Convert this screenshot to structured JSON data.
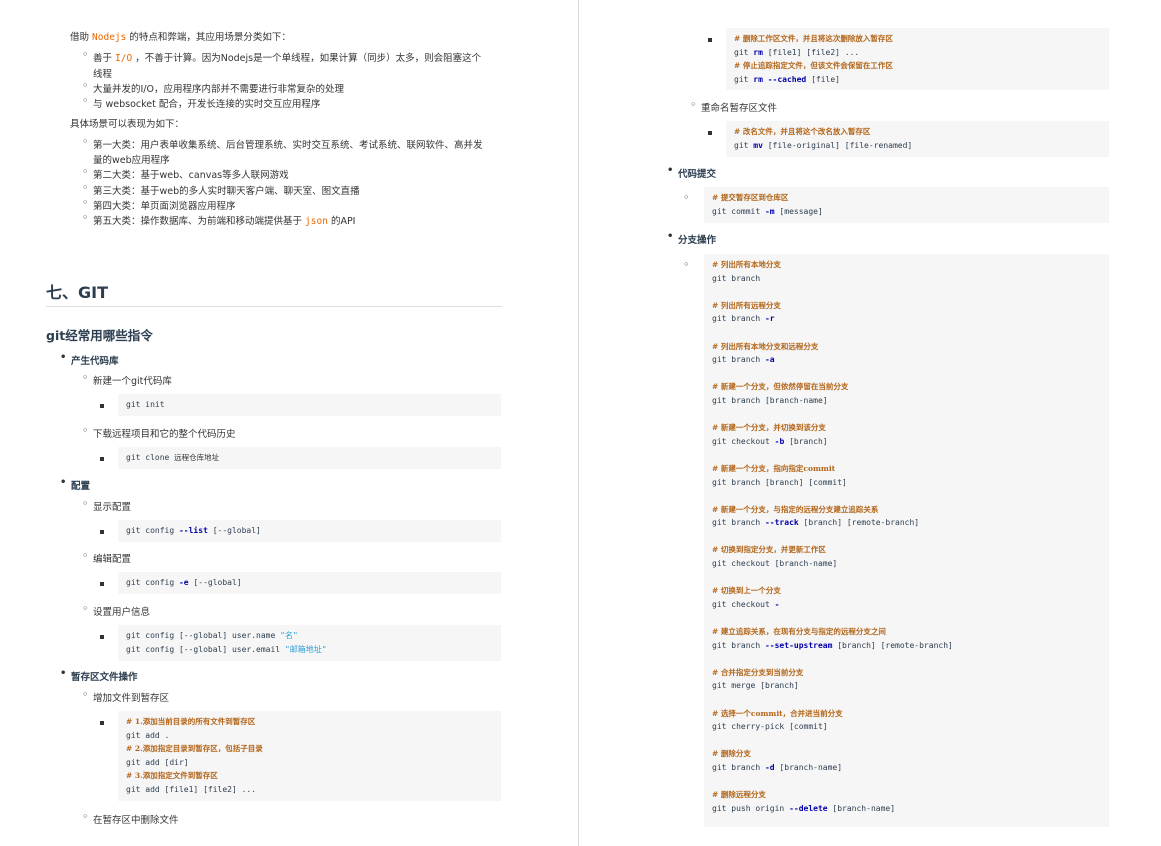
{
  "left": {
    "intro": {
      "pre": "借助 ",
      "code": "Nodejs",
      "post": " 的特点和弊端，其应用场景分类如下："
    },
    "features": [
      {
        "parts": [
          "善于 ",
          "I/O",
          " ，不善于计算。因为Nodejs是一个单线程，如果计算（同步）太多，则会阻塞这个"
        ],
        "cont": "线程"
      },
      {
        "text": "大量并发的I/O，应用程序内部并不需要进行非常复杂的处理"
      },
      {
        "text": "与 websocket 配合，开发长连接的实时交互应用程序"
      }
    ],
    "scene_intro": "具体场景可以表现为如下：",
    "scenes": [
      {
        "text": "第一大类：用户表单收集系统、后台管理系统、实时交互系统、考试系统、联网软件、高并发",
        "cont": "量的web应用程序"
      },
      {
        "text": "第二大类：基于web、canvas等多人联网游戏"
      },
      {
        "text": "第三大类：基于web的多人实时聊天客户端、聊天室、图文直播"
      },
      {
        "text": "第四大类：单页面浏览器应用程序"
      },
      {
        "pre": "第五大类：操作数据库、为前端和移动端提供基于 ",
        "code": "json",
        "post": " 的API"
      }
    ],
    "section_title": "七、GIT",
    "sub_title": "git经常用哪些指令",
    "groups": {
      "g1": "产生代码库",
      "g1a": "新建一个git代码库",
      "g1a_code": "git init",
      "g1b": "下载远程项目和它的整个代码历史",
      "g1b_code": {
        "cmd": "git clone ",
        "arg": "远程仓库地址"
      },
      "g2": "配置",
      "g2a": "显示配置",
      "g2a_code": {
        "a": "git config ",
        "b": "--list",
        "c": " [--global]"
      },
      "g2b": "编辑配置",
      "g2b_code": {
        "a": "git config ",
        "b": "-e",
        "c": " [--global]"
      },
      "g2c": "设置用户信息",
      "g2c_code1": {
        "a": "git config [--global] user.name ",
        "s": "\"名\""
      },
      "g2c_code2": {
        "a": "git config [--global] user.email ",
        "s": "\"邮箱地址\""
      },
      "g3": "暂存区文件操作",
      "g3a": "增加文件到暂存区",
      "g3a_lines": [
        {
          "t": "c",
          "v": "# 1.添加当前目录的所有文件到暂存区"
        },
        {
          "t": "n",
          "v": "git add ."
        },
        {
          "t": "c",
          "v": "# 2.添加指定目录到暂存区，包括子目录"
        },
        {
          "t": "n",
          "v": "git add [dir]"
        },
        {
          "t": "c",
          "v": "# 3.添加指定文件到暂存区"
        },
        {
          "t": "n",
          "v": "git add [file1] [file2] ..."
        }
      ],
      "g3b": "在暂存区中删除文件"
    }
  },
  "right": {
    "rm_lines": [
      {
        "t": "c",
        "v": "# 删除工作区文件，并且将这次删除放入暂存区"
      },
      {
        "t": "k",
        "a": "git ",
        "k": "rm",
        "b": " [file1] [file2] ..."
      },
      {
        "t": "c",
        "v": "# 停止追踪指定文件，但该文件会保留在工作区"
      },
      {
        "t": "k",
        "a": "git ",
        "k": "rm --cached",
        "b": " [file]"
      }
    ],
    "rename_label": "重命名暂存区文件",
    "mv_lines": [
      {
        "t": "c",
        "v": "# 改名文件，并且将这个改名放入暂存区"
      },
      {
        "t": "k",
        "a": "git ",
        "k": "mv",
        "b": " [file-original] [file-renamed]"
      }
    ],
    "commit_label": "代码提交",
    "commit_lines": [
      {
        "t": "c",
        "v": "# 提交暂存区到仓库区"
      },
      {
        "t": "k",
        "a": "git commit ",
        "k": "-m",
        "b": " [message]"
      }
    ],
    "branch_label": "分支操作",
    "branch_lines": [
      {
        "t": "c",
        "v": "# 列出所有本地分支"
      },
      {
        "t": "n",
        "v": "git branch"
      },
      {
        "t": "e"
      },
      {
        "t": "c",
        "v": "# 列出所有远程分支"
      },
      {
        "t": "k",
        "a": "git branch ",
        "k": "-r",
        "b": ""
      },
      {
        "t": "e"
      },
      {
        "t": "c",
        "v": "# 列出所有本地分支和远程分支"
      },
      {
        "t": "k",
        "a": "git branch ",
        "k": "-a",
        "b": ""
      },
      {
        "t": "e"
      },
      {
        "t": "c",
        "v": "# 新建一个分支，但依然停留在当前分支"
      },
      {
        "t": "n",
        "v": "git branch [branch-name]"
      },
      {
        "t": "e"
      },
      {
        "t": "c",
        "v": "# 新建一个分支，并切换到该分支"
      },
      {
        "t": "k",
        "a": "git checkout ",
        "k": "-b",
        "b": " [branch]"
      },
      {
        "t": "e"
      },
      {
        "t": "c",
        "v": "# 新建一个分支，指向指定commit"
      },
      {
        "t": "n",
        "v": "git branch [branch] [commit]"
      },
      {
        "t": "e"
      },
      {
        "t": "c",
        "v": "# 新建一个分支，与指定的远程分支建立追踪关系"
      },
      {
        "t": "k",
        "a": "git branch ",
        "k": "--track",
        "b": " [branch] [remote-branch]"
      },
      {
        "t": "e"
      },
      {
        "t": "c",
        "v": "# 切换到指定分支，并更新工作区"
      },
      {
        "t": "n",
        "v": "git checkout [branch-name]"
      },
      {
        "t": "e"
      },
      {
        "t": "c",
        "v": "# 切换到上一个分支"
      },
      {
        "t": "k",
        "a": "git checkout ",
        "k": "-",
        "b": ""
      },
      {
        "t": "e"
      },
      {
        "t": "c",
        "v": "# 建立追踪关系，在现有分支与指定的远程分支之间"
      },
      {
        "t": "k",
        "a": "git branch ",
        "k": "--set-upstream",
        "b": " [branch] [remote-branch]"
      },
      {
        "t": "e"
      },
      {
        "t": "c",
        "v": "# 合并指定分支到当前分支"
      },
      {
        "t": "n",
        "v": "git merge [branch]"
      },
      {
        "t": "e"
      },
      {
        "t": "c",
        "v": "# 选择一个commit，合并进当前分支"
      },
      {
        "t": "n",
        "v": "git cherry-pick [commit]"
      },
      {
        "t": "e"
      },
      {
        "t": "c",
        "v": "# 删除分支"
      },
      {
        "t": "k",
        "a": "git branch ",
        "k": "-d",
        "b": " [branch-name]"
      },
      {
        "t": "e"
      },
      {
        "t": "c",
        "v": "# 删除远程分支"
      },
      {
        "t": "k",
        "a": "git push origin ",
        "k": "--delete",
        "b": " [branch-name]"
      }
    ]
  }
}
